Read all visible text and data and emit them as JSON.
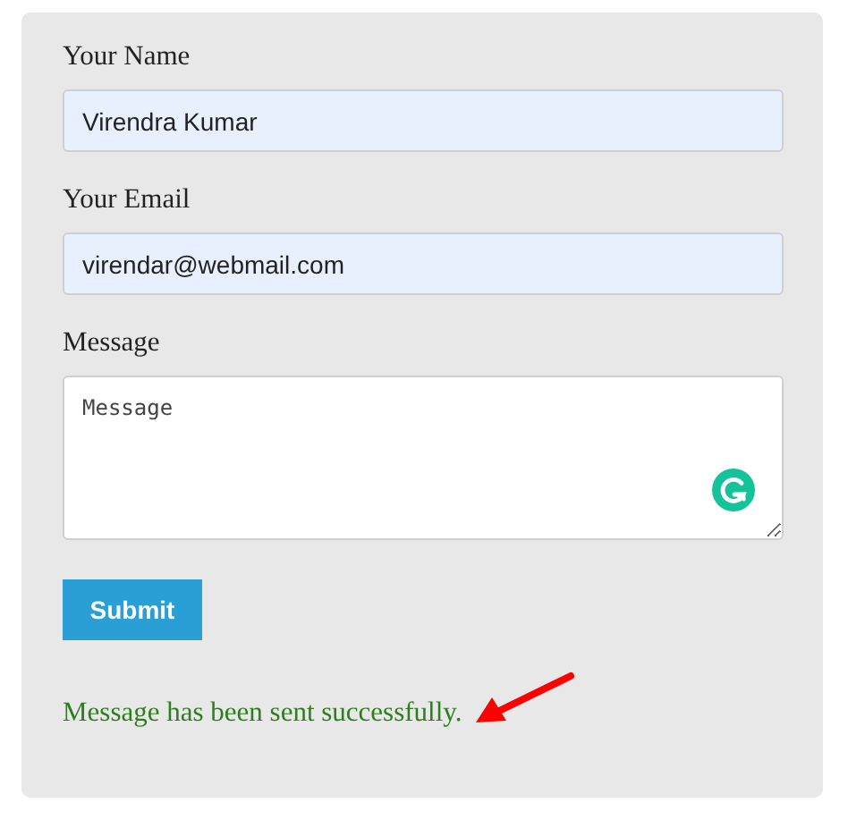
{
  "form": {
    "fields": [
      {
        "kind": "text",
        "label": "Your Name",
        "value": "Virendra Kumar"
      },
      {
        "kind": "text",
        "label": "Your Email",
        "value": "virendar@webmail.com"
      },
      {
        "kind": "textarea",
        "label": "Message",
        "placeholder": "Message"
      }
    ],
    "submit": "Submit",
    "status": "Message has been sent successfully."
  }
}
